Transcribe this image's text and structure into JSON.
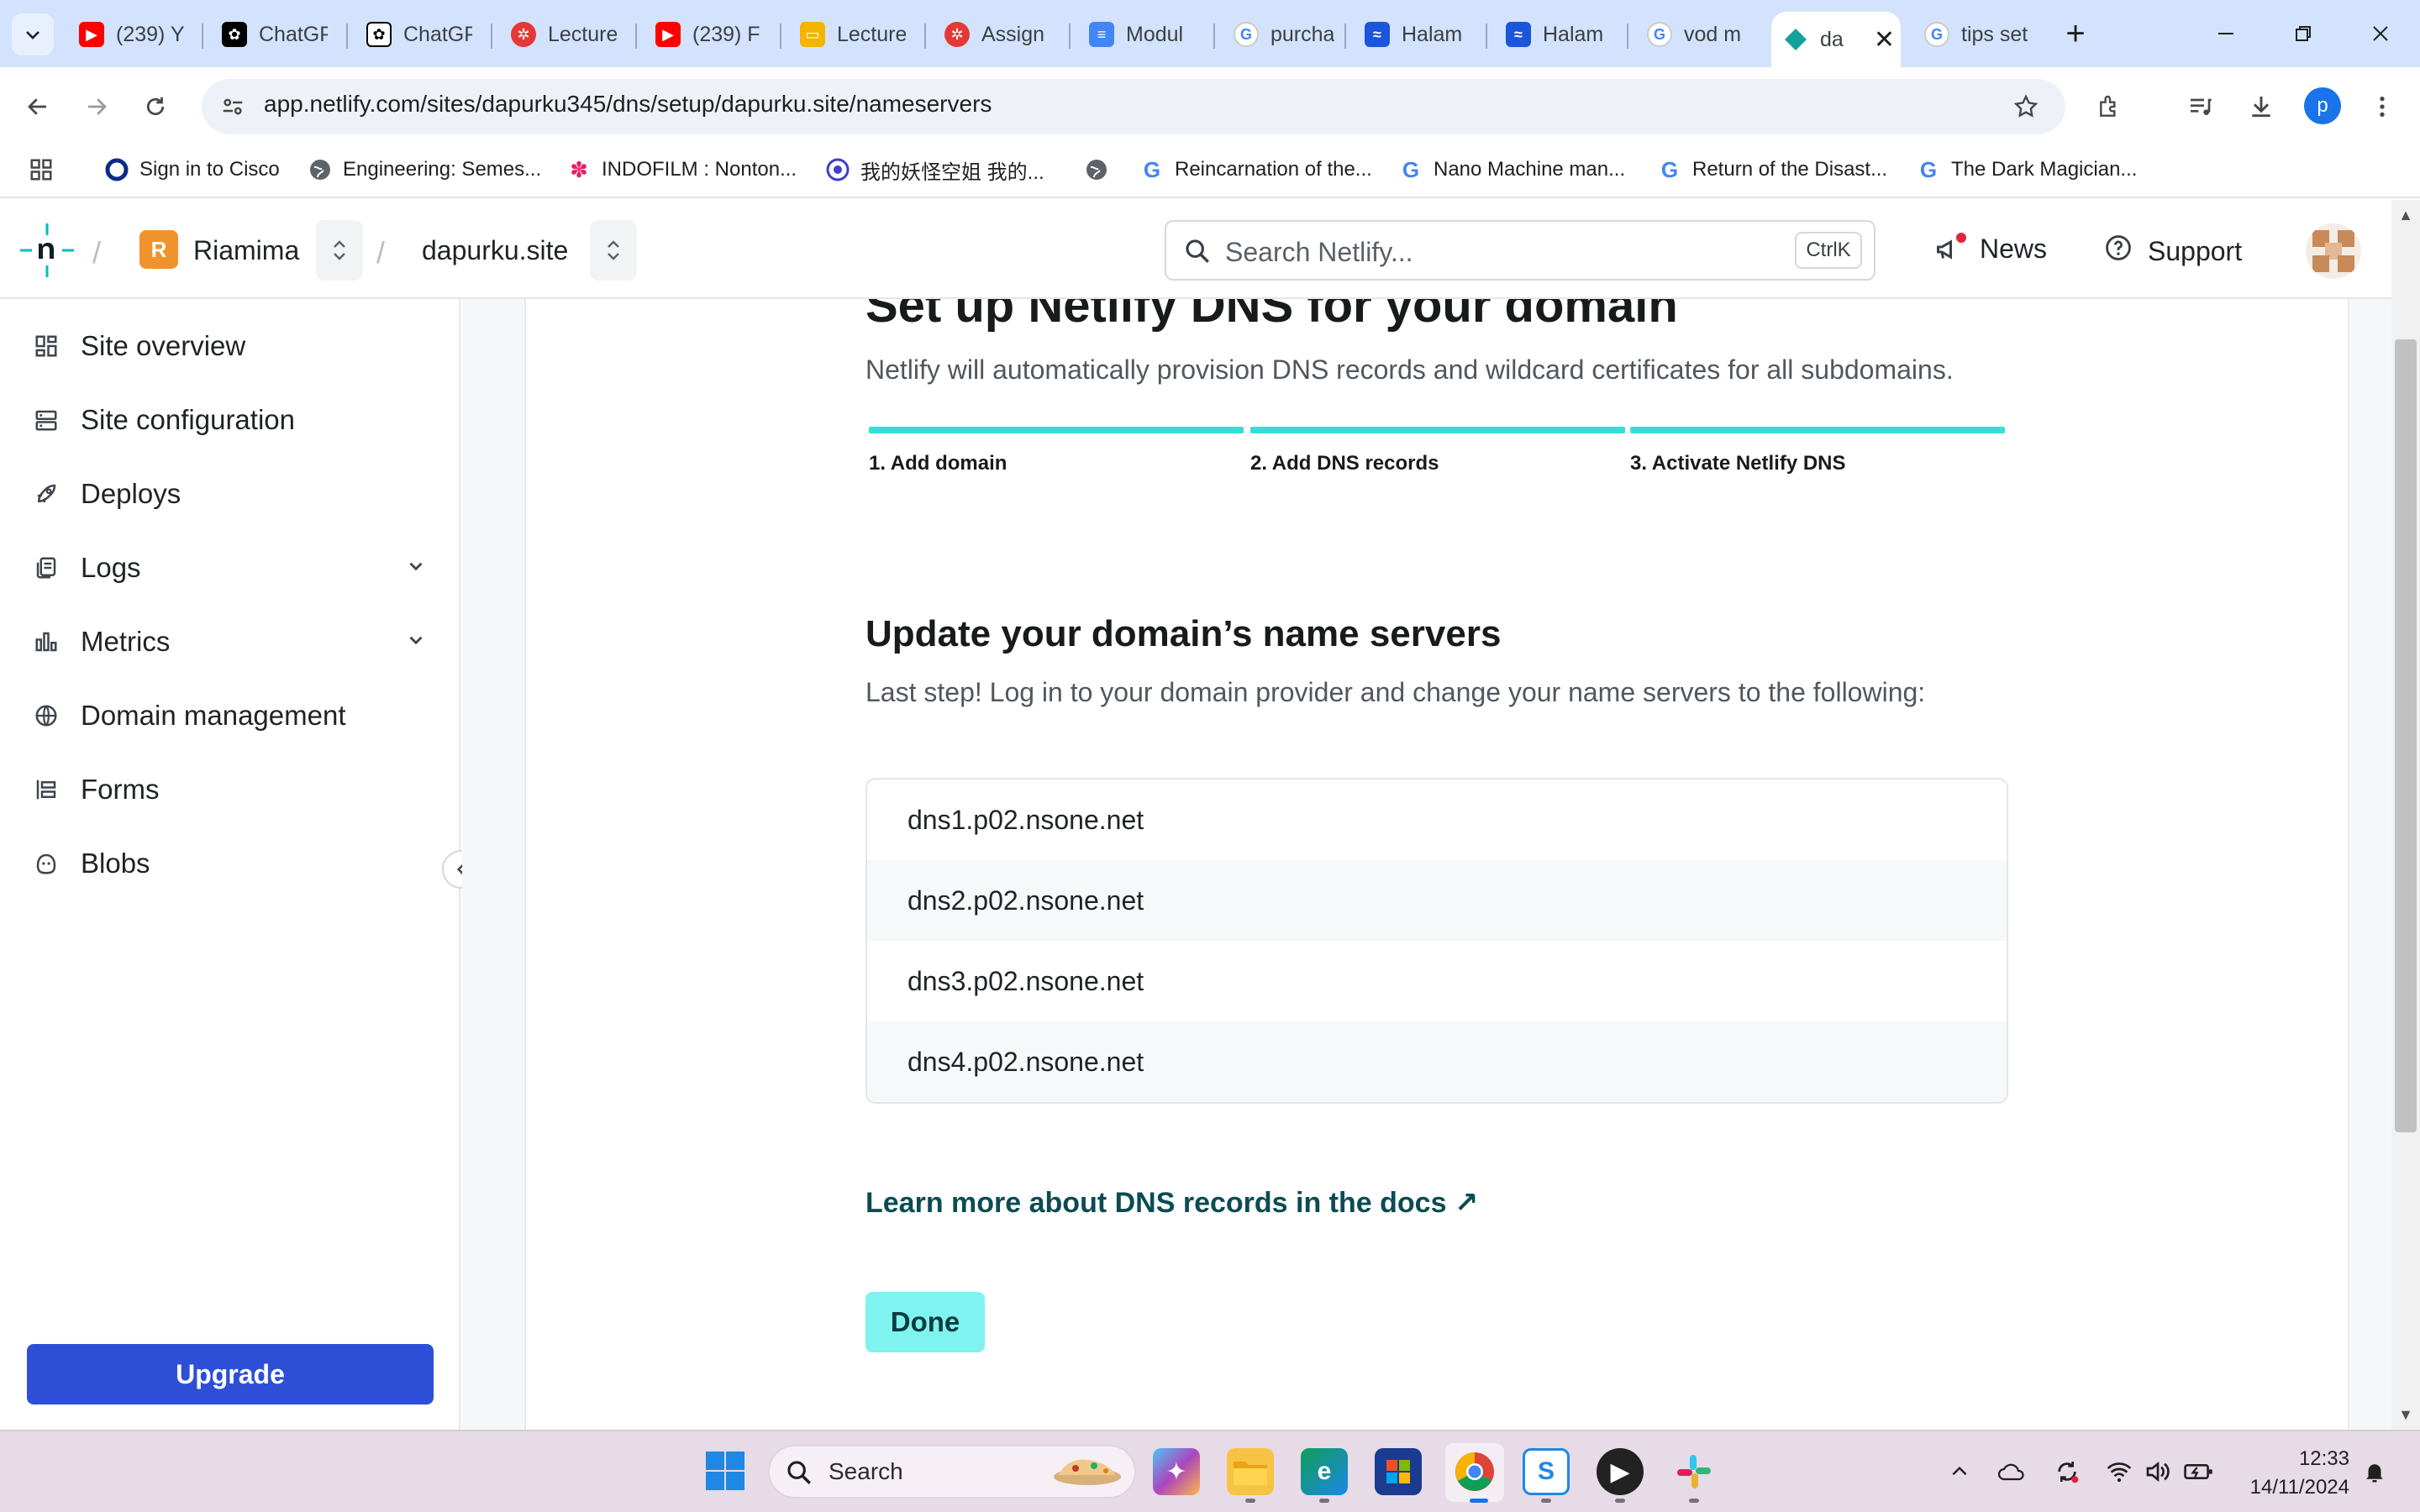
{
  "browser": {
    "tabs": [
      {
        "title": "(239) Y",
        "favicon": "youtube-icon",
        "color": "#ff0000"
      },
      {
        "title": "ChatGP",
        "favicon": "chatgpt-icon",
        "color": "#000000"
      },
      {
        "title": "ChatGP",
        "favicon": "chatgpt-icon",
        "color": "#000000"
      },
      {
        "title": "Lecture",
        "favicon": "gear-red-icon",
        "color": "#e53935"
      },
      {
        "title": "(239) F",
        "favicon": "youtube-icon",
        "color": "#ff0000"
      },
      {
        "title": "Lecture",
        "favicon": "slides-icon",
        "color": "#f4b400"
      },
      {
        "title": "Assign",
        "favicon": "gear-red-icon",
        "color": "#e53935"
      },
      {
        "title": "Modul",
        "favicon": "docs-icon",
        "color": "#4285f4"
      },
      {
        "title": "purcha",
        "favicon": "google-icon",
        "color": "#4285f4"
      },
      {
        "title": "Halam",
        "favicon": "wave-icon",
        "color": "#1a56db"
      },
      {
        "title": "Halam",
        "favicon": "wave-icon",
        "color": "#1a56db"
      },
      {
        "title": "vod m",
        "favicon": "google-icon",
        "color": "#4285f4"
      },
      {
        "title": "da",
        "favicon": "netlify-icon",
        "color": "#14a09b",
        "active": true
      },
      {
        "title": "tips set",
        "favicon": "google-icon",
        "color": "#4285f4"
      }
    ],
    "url": "app.netlify.com/sites/dapurku345/dns/setup/dapurku.site/nameservers",
    "profile_initial": "p",
    "bookmarks": [
      {
        "label": "Sign in to Cisco",
        "icon": "cisco-icon"
      },
      {
        "label": "Engineering: Semes...",
        "icon": "globe-icon"
      },
      {
        "label": "INDOFILM : Nonton...",
        "icon": "indofilm-icon"
      },
      {
        "label": "我的妖怪空姐 我的...",
        "icon": "circle-logo-icon"
      },
      {
        "label": "",
        "icon": "globe-icon"
      },
      {
        "label": "Reincarnation of the...",
        "icon": "google-icon"
      },
      {
        "label": "Nano Machine man...",
        "icon": "google-icon"
      },
      {
        "label": "Return of the Disast...",
        "icon": "google-icon"
      },
      {
        "label": "The Dark Magician...",
        "icon": "google-icon"
      }
    ]
  },
  "header": {
    "team_initial": "R",
    "team_name": "Riamima",
    "site_name": "dapurku.site",
    "search_placeholder": "Search Netlify...",
    "search_shortcut": "CtrlK",
    "news_label": "News",
    "support_label": "Support"
  },
  "sidebar": {
    "items": [
      {
        "label": "Site overview",
        "icon": "grid-icon"
      },
      {
        "label": "Site configuration",
        "icon": "config-icon"
      },
      {
        "label": "Deploys",
        "icon": "rocket-icon"
      },
      {
        "label": "Logs",
        "icon": "logs-icon",
        "expandable": true
      },
      {
        "label": "Metrics",
        "icon": "metrics-icon",
        "expandable": true
      },
      {
        "label": "Domain management",
        "icon": "globe-icon"
      },
      {
        "label": "Forms",
        "icon": "forms-icon"
      },
      {
        "label": "Blobs",
        "icon": "blobs-icon"
      }
    ],
    "upgrade_label": "Upgrade"
  },
  "main": {
    "title": "Set up Netlify DNS for your domain",
    "subtitle": "Netlify will automatically provision DNS records and wildcard certificates for all subdomains.",
    "steps": [
      "1. Add domain",
      "2. Add DNS records",
      "3. Activate Netlify DNS"
    ],
    "section_title": "Update your domain’s name servers",
    "section_text": "Last step! Log in to your domain provider and change your name servers to the following:",
    "nameservers": [
      "dns1.p02.nsone.net",
      "dns2.p02.nsone.net",
      "dns3.p02.nsone.net",
      "dns4.p02.nsone.net"
    ],
    "learn_more": "Learn more about DNS records in the docs ↗",
    "done_label": "Done"
  },
  "taskbar": {
    "search_label": "Search",
    "time": "12:33",
    "date": "14/11/2024"
  },
  "colors": {
    "accent_teal": "#35dfd9",
    "done_bg": "#7ff3ef",
    "upgrade_bg": "#2d4fd8",
    "link": "#0b4c53"
  }
}
